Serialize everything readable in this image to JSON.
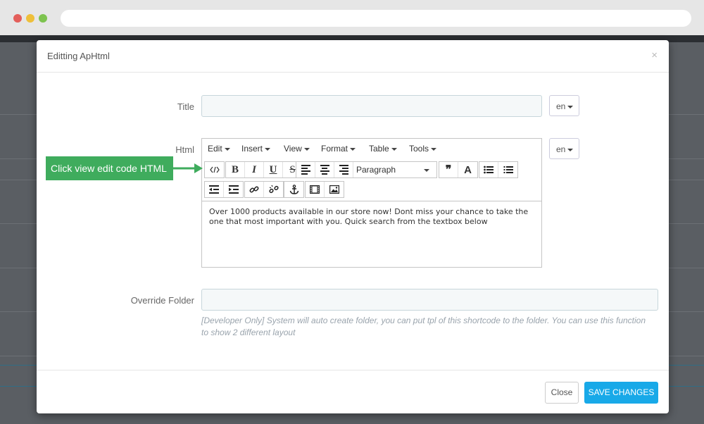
{
  "modal": {
    "title": "Editting ApHtml",
    "close_symbol": "×"
  },
  "form": {
    "title_label": "Title",
    "html_label": "Html",
    "override_label": "Override Folder",
    "title_value": "",
    "override_value": "",
    "language": "en",
    "override_help": "[Developer Only] System will auto create folder, you can put tpl of this shortcode to the folder. You can use this function to show 2 different layout"
  },
  "editor": {
    "menus": [
      "Edit",
      "Insert",
      "View",
      "Format",
      "Table",
      "Tools"
    ],
    "block_format": "Paragraph",
    "content": "Over 1000 products available in our store now! Dont miss your chance to take the one that most important with you. Quick search from the textbox below"
  },
  "annotation": {
    "text": "Click view edit code HTML",
    "color": "#3fac5d"
  },
  "footer": {
    "close_label": "Close",
    "save_label": "SAVE CHANGES",
    "save_color": "#18a9e8"
  }
}
